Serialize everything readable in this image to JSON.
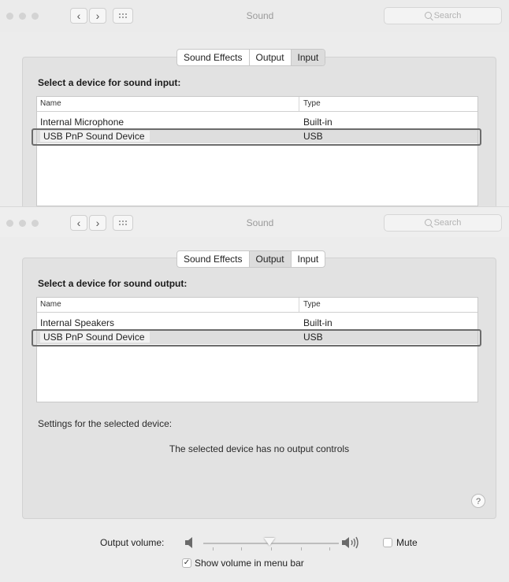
{
  "window": {
    "title": "Sound",
    "search_placeholder": "Search"
  },
  "nav": {
    "back": "‹",
    "forward": "›"
  },
  "tabs": [
    {
      "label": "Sound Effects"
    },
    {
      "label": "Output"
    },
    {
      "label": "Input"
    }
  ],
  "input_section": {
    "heading": "Select a device for sound input:",
    "columns": {
      "name": "Name",
      "type": "Type"
    },
    "devices": [
      {
        "name": "Internal Microphone",
        "type": "Built-in"
      },
      {
        "name": "USB PnP Sound Device",
        "type": "USB"
      }
    ],
    "selected_index": 1
  },
  "output_section": {
    "heading": "Select a device for sound output:",
    "columns": {
      "name": "Name",
      "type": "Type"
    },
    "devices": [
      {
        "name": "Internal Speakers",
        "type": "Built-in"
      },
      {
        "name": "USB PnP Sound Device",
        "type": "USB"
      }
    ],
    "selected_index": 1,
    "settings_label": "Settings for the selected device:",
    "no_controls": "The selected device has no output controls",
    "help": "?"
  },
  "volume": {
    "label": "Output volume:",
    "level": 0.5,
    "mute_label": "Mute",
    "mute_checked": false,
    "show_in_menu_bar_label": "Show volume in menu bar",
    "show_in_menu_bar_checked": true,
    "check_glyph": "✓"
  },
  "icons": {
    "search": "search-icon",
    "grid": "grid-icon",
    "speaker_low": "speaker-low-icon",
    "speaker_high": "speaker-high-icon"
  }
}
